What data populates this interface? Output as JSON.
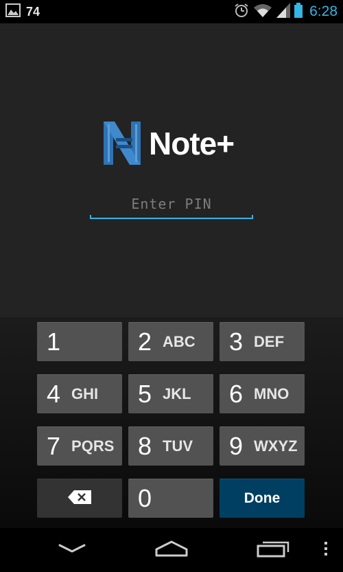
{
  "status_bar": {
    "notification_count": "74",
    "time": "6:28",
    "icons": [
      "image-icon",
      "alarm-icon",
      "wifi-icon",
      "signal-icon",
      "battery-icon"
    ]
  },
  "app": {
    "name": "Note+",
    "logo_icon": "note-plus-logo",
    "pin_placeholder": "Enter PIN",
    "pin_value": ""
  },
  "keypad": {
    "keys": [
      {
        "digit": "1",
        "letters": ""
      },
      {
        "digit": "2",
        "letters": "ABC"
      },
      {
        "digit": "3",
        "letters": "DEF"
      },
      {
        "digit": "4",
        "letters": "GHI"
      },
      {
        "digit": "5",
        "letters": "JKL"
      },
      {
        "digit": "6",
        "letters": "MNO"
      },
      {
        "digit": "7",
        "letters": "PQRS"
      },
      {
        "digit": "8",
        "letters": "TUV"
      },
      {
        "digit": "9",
        "letters": "WXYZ"
      },
      {
        "digit": "0",
        "letters": ""
      }
    ],
    "delete_icon": "backspace-icon",
    "done_label": "Done"
  },
  "nav_bar": {
    "icons": [
      "back-icon",
      "home-icon",
      "recent-apps-icon",
      "overflow-menu-icon"
    ]
  },
  "colors": {
    "accent": "#33b5e5",
    "done_key": "#003f62",
    "key": "#525252",
    "logo_blue": "#2f73b3"
  }
}
